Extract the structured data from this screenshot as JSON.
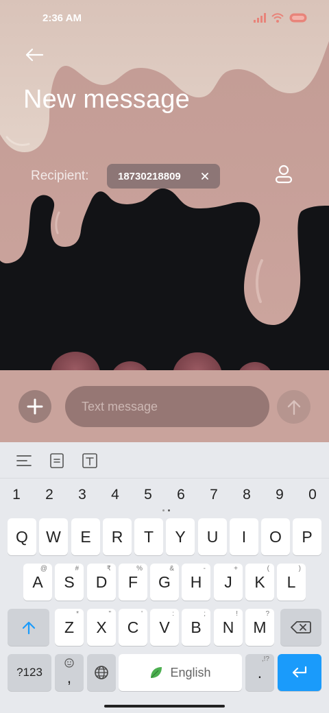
{
  "status_bar": {
    "time": "2:36 AM",
    "icons": [
      "signal-icon",
      "wifi-icon",
      "battery-icon"
    ]
  },
  "header": {
    "back_icon": "back-arrow-icon",
    "title": "New message"
  },
  "recipient": {
    "label": "Recipient:",
    "chip_value": "18730218809",
    "chip_close_icon": "close-icon",
    "contact_icon": "contact-icon"
  },
  "compose": {
    "attach_icon": "plus-icon",
    "placeholder": "Text message",
    "value": "",
    "send_icon": "send-arrow-icon"
  },
  "keyboard_toolbar": {
    "tools": [
      "menu-lines-icon",
      "clipboard-icon",
      "text-format-icon"
    ]
  },
  "keyboard": {
    "numbers": [
      "1",
      "2",
      "3",
      "4",
      "5",
      "6",
      "7",
      "8",
      "9",
      "0"
    ],
    "row1": [
      "Q",
      "W",
      "E",
      "R",
      "T",
      "Y",
      "U",
      "I",
      "O",
      "P"
    ],
    "row2": [
      "A",
      "S",
      "D",
      "F",
      "G",
      "H",
      "J",
      "K",
      "L"
    ],
    "row2_hints": [
      "@",
      "#",
      "₹",
      "%",
      "&",
      "-",
      "+",
      "(",
      ")"
    ],
    "row3": [
      "Z",
      "X",
      "C",
      "V",
      "B",
      "N",
      "M"
    ],
    "row3_hints": [
      "*",
      "\"",
      "'",
      ":",
      ";",
      "!",
      "?"
    ],
    "symbols_label": "?123",
    "comma_label": ",",
    "space_label": "English",
    "period_label": ".",
    "period_hint": ",!?"
  },
  "colors": {
    "accent": "#1a9bfb",
    "compose_bar": "#c9a39c",
    "drip_pink": "#c9a19a",
    "keyboard_bg": "#e7e9ed"
  }
}
